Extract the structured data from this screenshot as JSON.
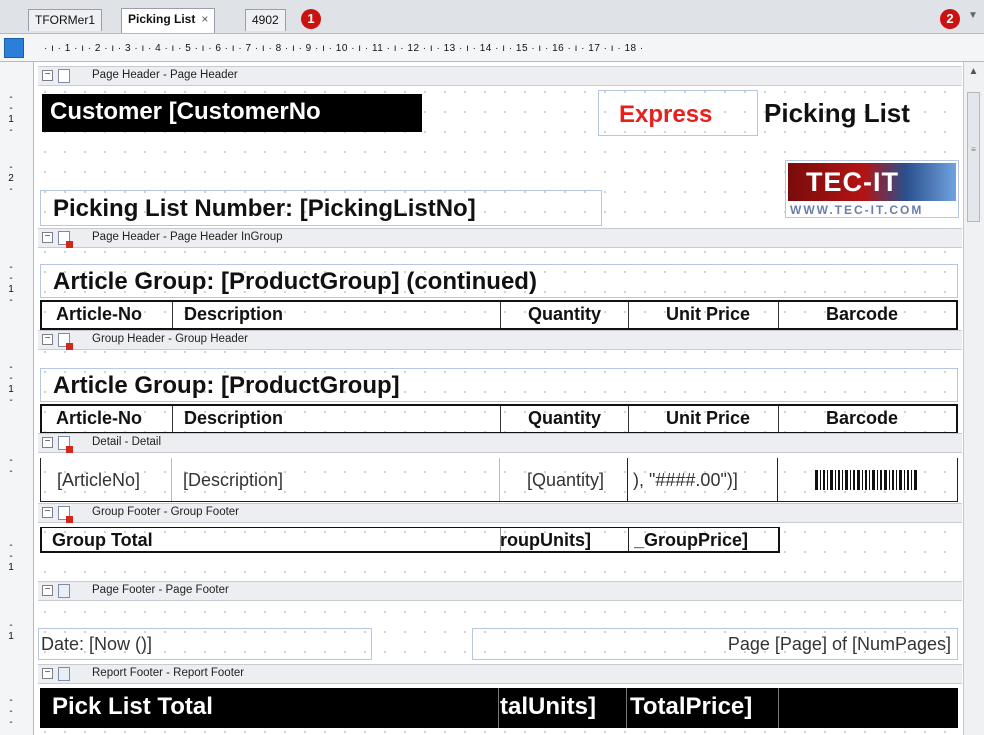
{
  "tabs": [
    {
      "label": "TFORMer1"
    },
    {
      "label": "Picking List",
      "close": "×"
    },
    {
      "label": "4902"
    }
  ],
  "badges": {
    "one": "1",
    "two": "2"
  },
  "ruler": {
    "horizontal": "· ı · 1 · ı · 2 · ı · 3 · ı · 4 · ı · 5 · ı · 6 · ı · 7 · ı · 8 · ı · 9 · ı · 10 · ı · 11 · ı · 12 · ı · 13 · ı · 14 · ı · 15 · ı · 16 · ı · 17 · ı · 18 ·",
    "vertical_labels": [
      "1",
      "2",
      "1",
      "1",
      "1",
      "1"
    ]
  },
  "bands": {
    "page_header": "Page Header - Page Header",
    "page_header_ingroup": "Page Header - Page Header InGroup",
    "group_header": "Group Header - Group Header",
    "detail": "Detail - Detail",
    "group_footer": "Group Footer - Group Footer",
    "page_footer": "Page Footer - Page Footer",
    "report_footer": "Report Footer - Report Footer"
  },
  "page_header": {
    "customer": "Customer [CustomerNo",
    "express": "Express",
    "picking_list": "Picking List",
    "logo_main": "TEC-IT",
    "logo_url": "WWW.TEC-IT.COM",
    "picking_list_number": "Picking List Number: [PickingListNo]"
  },
  "ingroup": {
    "title": "Article Group: [ProductGroup] (continued)"
  },
  "group_header": {
    "title": "Article Group: [ProductGroup]"
  },
  "columns": {
    "article_no": "Article-No",
    "description": "Description",
    "quantity": "Quantity",
    "unit_price": "Unit Price",
    "barcode": "Barcode"
  },
  "detail": {
    "article_no": "[ArticleNo]",
    "description": "[Description]",
    "quantity": "[Quantity]",
    "unit_price": "), \"####.00\")]"
  },
  "group_footer": {
    "label": "Group Total",
    "units": "roupUnits]",
    "price": "_GroupPrice]"
  },
  "page_footer": {
    "date": "Date: [Now ()]",
    "page": "Page [Page] of [NumPages]"
  },
  "report_footer": {
    "label": "Pick List Total",
    "units": "talUnits]",
    "price": "TotalPrice]"
  },
  "colors": {
    "express": "#e8201b",
    "black_band": "#000000",
    "ruler_corner": "#2b7fd8",
    "badge": "#cc1111"
  },
  "icons": [
    "collapse-icon",
    "band-icon",
    "close-icon",
    "chevron-down-icon",
    "barcode-icon",
    "logo-icon"
  ]
}
